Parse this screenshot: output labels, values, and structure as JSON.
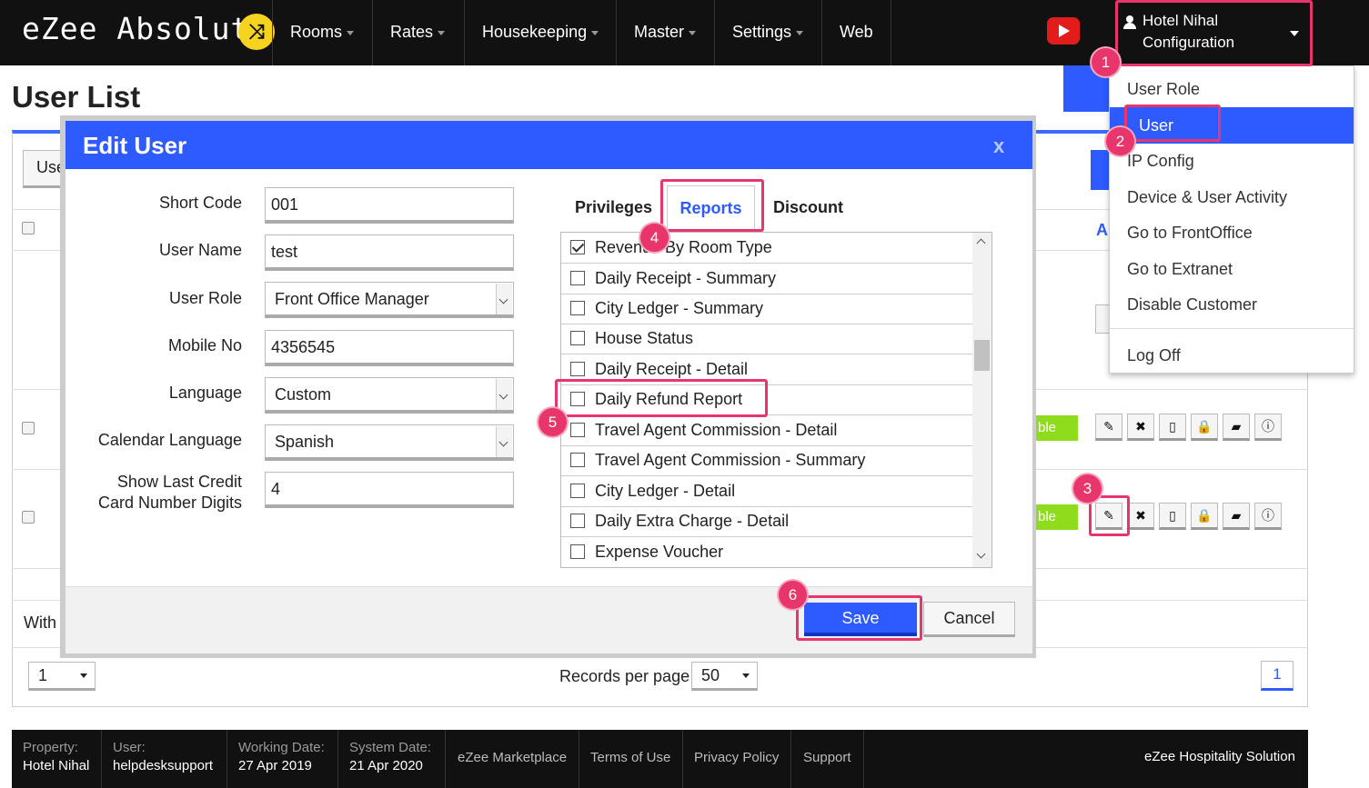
{
  "app": {
    "logo": "eZee Absolute",
    "logo_icon": "shuffle-icon"
  },
  "nav": [
    "Rooms",
    "Rates",
    "Housekeeping",
    "Master",
    "Settings",
    "Web"
  ],
  "account": {
    "hotel": "Hotel Nihal",
    "section": "Configuration"
  },
  "menu": [
    "User Role",
    "User",
    "IP Config",
    "Device & User Activity",
    "Go to FrontOffice",
    "Go to Extranet",
    "Disable Customer",
    "Log Off"
  ],
  "page": {
    "title": "User List",
    "tab_partial": "Use",
    "with_partial": "With",
    "header_partial": "A",
    "enable_partial": "ble"
  },
  "modal": {
    "title": "Edit User",
    "close": "x",
    "fields": [
      {
        "label": "Short Code",
        "value": "001"
      },
      {
        "label": "User Name",
        "value": "test"
      },
      {
        "label": "User Role",
        "value": "Front Office Manager"
      },
      {
        "label": "Mobile No",
        "value": "4356545"
      },
      {
        "label": "Language",
        "value": "Custom"
      },
      {
        "label": "Calendar Language",
        "value": "Spanish"
      },
      {
        "label": "Show Last Credit",
        "label2": "Card Number Digits",
        "value": "4"
      }
    ],
    "tabs": {
      "privileges": "Privileges",
      "reports": "Reports",
      "discount": "Discount"
    },
    "reports": [
      {
        "label": "Revenue By Room Type",
        "checked": true
      },
      {
        "label": "Daily Receipt - Summary",
        "checked": false
      },
      {
        "label": "City Ledger - Summary",
        "checked": false
      },
      {
        "label": "House Status",
        "checked": false
      },
      {
        "label": "Daily Receipt - Detail",
        "checked": false
      },
      {
        "label": "Daily Refund Report",
        "checked": false
      },
      {
        "label": "Travel Agent Commission - Detail",
        "checked": false
      },
      {
        "label": "Travel Agent Commission - Summary",
        "checked": false
      },
      {
        "label": "City Ledger - Detail",
        "checked": false
      },
      {
        "label": "Daily Extra Charge - Detail",
        "checked": false
      },
      {
        "label": "Expense Voucher",
        "checked": false
      }
    ],
    "save": "Save",
    "cancel": "Cancel"
  },
  "steps": [
    "1",
    "2",
    "3",
    "4",
    "5",
    "6"
  ],
  "pagination": {
    "page_select": "1",
    "records_label": "Records per page",
    "records_value": "50",
    "current_page": "1"
  },
  "footer": {
    "property_label": "Property:",
    "property": "Hotel Nihal",
    "user_label": "User:",
    "user": "helpdesksupport",
    "working_label": "Working Date:",
    "working": "27 Apr 2019",
    "system_label": "System Date:",
    "system": "21 Apr 2020",
    "links": [
      "eZee Marketplace",
      "Terms of Use",
      "Privacy Policy",
      "Support"
    ],
    "brand": "eZee Hospitality Solution"
  },
  "colors": {
    "accent": "#2d5bff",
    "highlight": "#e8356b",
    "enabled": "#8fdc1c"
  }
}
